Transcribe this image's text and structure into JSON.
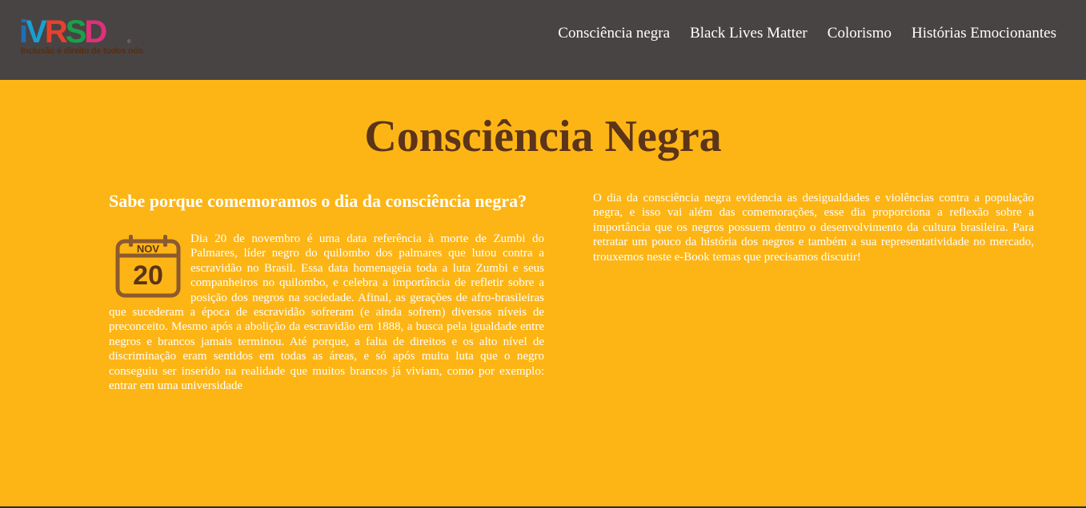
{
  "header": {
    "logo": {
      "letters": "iVRSD",
      "tagline": "Inclusão é direito de todos nós",
      "reg": "®"
    },
    "nav": [
      {
        "label": "Consciência negra"
      },
      {
        "label": "Black Lives Matter"
      },
      {
        "label": "Colorismo"
      },
      {
        "label": "Histórias Emocionantes"
      }
    ]
  },
  "main": {
    "title": "Consciência Negra",
    "left": {
      "subtitle": "Sabe porque comemoramos o dia da consciência negra?",
      "calendar": {
        "month": "NOV",
        "day": "20",
        "icon": "calendar-icon"
      },
      "paragraph": "Dia 20 de novembro é uma data referência à morte de Zumbi do Palmares, líder negro do quilombo dos palmares que lutou contra a escravidão no Brasil. Essa data homenageia toda a luta Zumbi e seus companheiros no quilombo, e celebra a importância de refletir sobre a posição dos negros na sociedade. Afinal, as gerações de afro-brasileiras que sucederam a época de escravidão sofreram (e ainda sofrem) diversos níveis de preconceito. Mesmo após a abolição da escravidão em 1888, a busca pela igualdade entre negros e brancos jamais terminou. Até porque, a falta de direitos e os alto nível de discriminação eram sentidos em todas as áreas, e só após muita luta que o negro conseguiu ser inserido na realidade que muitos brancos já viviam, como por exemplo: entrar em uma universidade"
    },
    "right": {
      "paragraph": "O dia da consciência negra evidencia as desigualdades e violências contra a população negra, e isso vai além das comemorações, esse dia proporciona a reflexão sobre a importância que os negros possuem dentro o desenvolvimento da cultura brasileira. Para retratar um pouco da história dos negros e também a sua representatividade no mercado, trouxemos neste e-Book temas que precisamos discutir!"
    }
  },
  "colors": {
    "header_bg": "#484444",
    "page_bg": "#FDB515",
    "title": "#5B3419",
    "calendar": "#8C5A2F"
  }
}
